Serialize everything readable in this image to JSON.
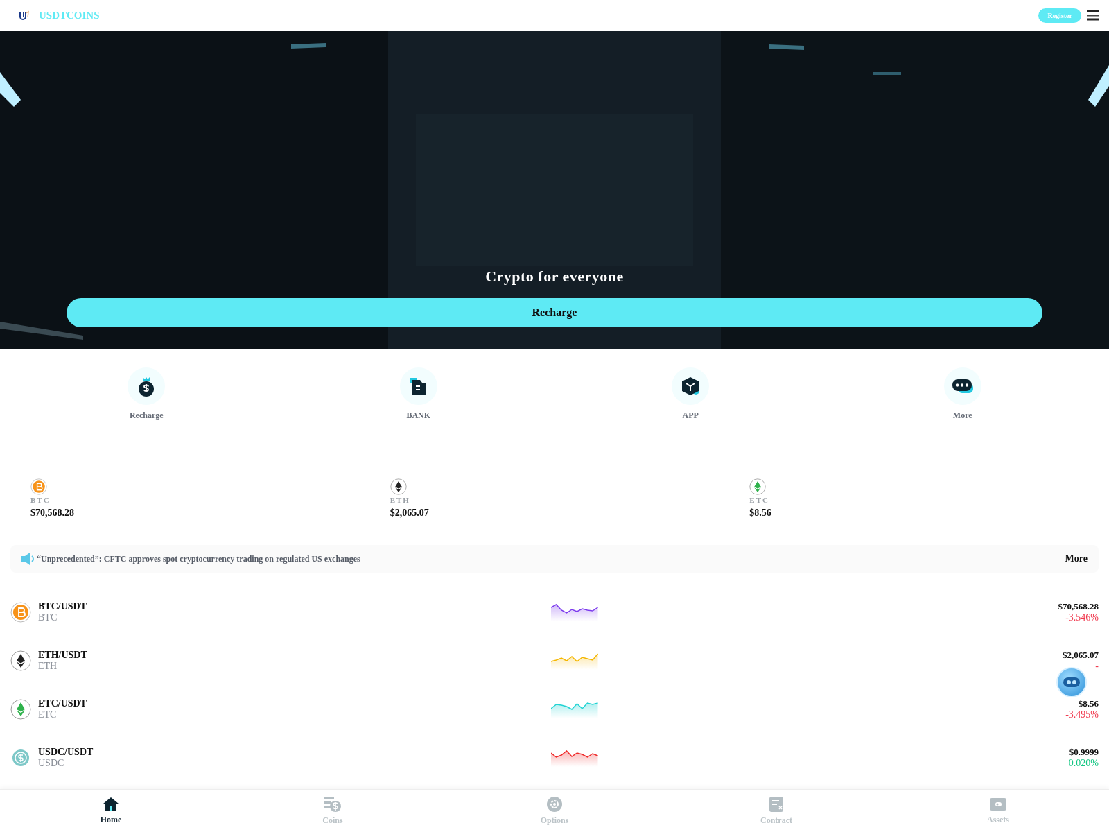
{
  "header": {
    "brand": "USDTCOINS",
    "register": "Register"
  },
  "hero": {
    "kind": "picture",
    "title": "Crypto for everyone",
    "button": "Recharge"
  },
  "shortcuts": [
    {
      "label": "Recharge",
      "kind": "bag"
    },
    {
      "label": "BANK",
      "kind": "bank"
    },
    {
      "label": "APP",
      "kind": "cube"
    },
    {
      "label": "More",
      "kind": "chat"
    }
  ],
  "tickers": [
    {
      "symbol": "BTC",
      "price": "$70,568.28",
      "kind": "btc"
    },
    {
      "symbol": "ETH",
      "price": "$2,065.07",
      "kind": "eth"
    },
    {
      "symbol": "ETC",
      "price": "$8.56",
      "kind": "etc"
    }
  ],
  "news": {
    "text": "“Unprecedented”: CFTC approves spot cryptocurrency trading on regulated US exchanges",
    "more": "More"
  },
  "markets": [
    {
      "pair": "BTC/USDT",
      "base": "BTC",
      "kind": "btc",
      "color": "#7c3aed",
      "price": "$70,568.28",
      "change": "-3.546%",
      "up": false
    },
    {
      "pair": "ETH/USDT",
      "base": "ETH",
      "kind": "eth",
      "color": "#f5b700",
      "price": "$2,065.07",
      "change": "-",
      "up": false
    },
    {
      "pair": "ETC/USDT",
      "base": "ETC",
      "kind": "etc",
      "color": "#22d3d3",
      "price": "$8.56",
      "change": "-3.495%",
      "up": false
    },
    {
      "pair": "USDC/USDT",
      "base": "USDC",
      "kind": "usdc",
      "color": "#ef2b2b",
      "price": "$0.9999",
      "change": "0.020%",
      "up": true
    }
  ],
  "nav": [
    {
      "label": "Home",
      "kind": "home",
      "selected": true
    },
    {
      "label": "Coins",
      "kind": "coins",
      "selected": false
    },
    {
      "label": "Options",
      "kind": "options",
      "selected": false
    },
    {
      "label": "Contract",
      "kind": "contract",
      "selected": false
    },
    {
      "label": "Assets",
      "kind": "assets",
      "selected": false
    }
  ]
}
